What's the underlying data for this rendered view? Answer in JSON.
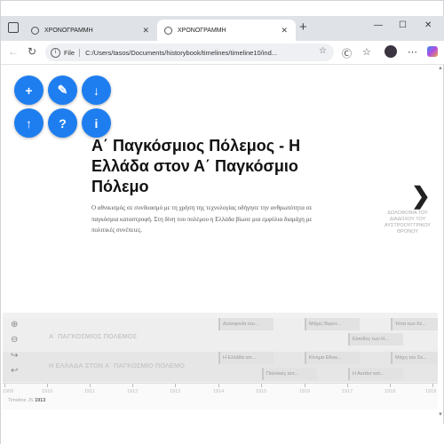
{
  "browser": {
    "tabs": [
      {
        "title": "ΧΡΟΝΟΓΡΑΜΜΗ"
      },
      {
        "title": "ΧΡΟΝΟΓΡΑΜΜΗ"
      }
    ],
    "file_label": "File",
    "url": "C:/Users/tasos/Documents/historybook/timelines/timeline10/ind..."
  },
  "fab": {
    "add": "+",
    "edit": "✎",
    "download": "↓",
    "upload": "↑",
    "help": "?",
    "info": "i"
  },
  "slide": {
    "title": "Α΄ Παγκόσμιος Πόλεμος - Η Ελλάδα στον Α΄ Παγκόσμιο Πόλεμο",
    "description": "Ο αθνικισμός σε συνδυασμό με τη χρήση της τεχνολογίας οδήγησε την ανθρωπότητα σε παγκόσμια καταστροφή. Στη δίνη του πολέμου η Ελλάδα βίωσε μια εμφύλια διαμάχη με πολιτικές συνέπειες.",
    "next_label": "ΔΟΛΟΦΟΝΙΑ ΤΟΥ ΔΙΑΔΟΧΟΥ ΤΟΥ ΑΥΣΤΡΟΟΥΓΓΡΙΚΟΥ ΘΡΟΝΟΥ"
  },
  "timeline": {
    "groups": [
      {
        "label": "Α΄ ΠΑΓΚΟΣΜΙΟΣ ΠΟΛΕΜΟΣ"
      },
      {
        "label": "Η ΕΛΛΑΔΑ ΣΤΟΝ Α΄ ΠΑΓΚΟΣΜΙΟ ΠΟΛΕΜΟ"
      }
    ],
    "events": [
      {
        "label": "Δολοφονία του..."
      },
      {
        "label": "Μάχες Βερντ..."
      },
      {
        "label": "Ήττα των Κε..."
      },
      {
        "label": "Είσοδος των Η..."
      },
      {
        "label": "Η Ελλάδα απ..."
      },
      {
        "label": "Κίνημα Εθνικ..."
      },
      {
        "label": "Μάχη του Σκ..."
      },
      {
        "label": "Πολιτικές αντ..."
      },
      {
        "label": "Η Αντάντ κατ..."
      }
    ],
    "axis_years": [
      "1909",
      "1910",
      "1911",
      "1912",
      "1913",
      "1914",
      "1915",
      "1916",
      "1917",
      "1918",
      "1919"
    ],
    "axis_start_prefix": "Timeline JS",
    "axis_start_year": "1913"
  }
}
